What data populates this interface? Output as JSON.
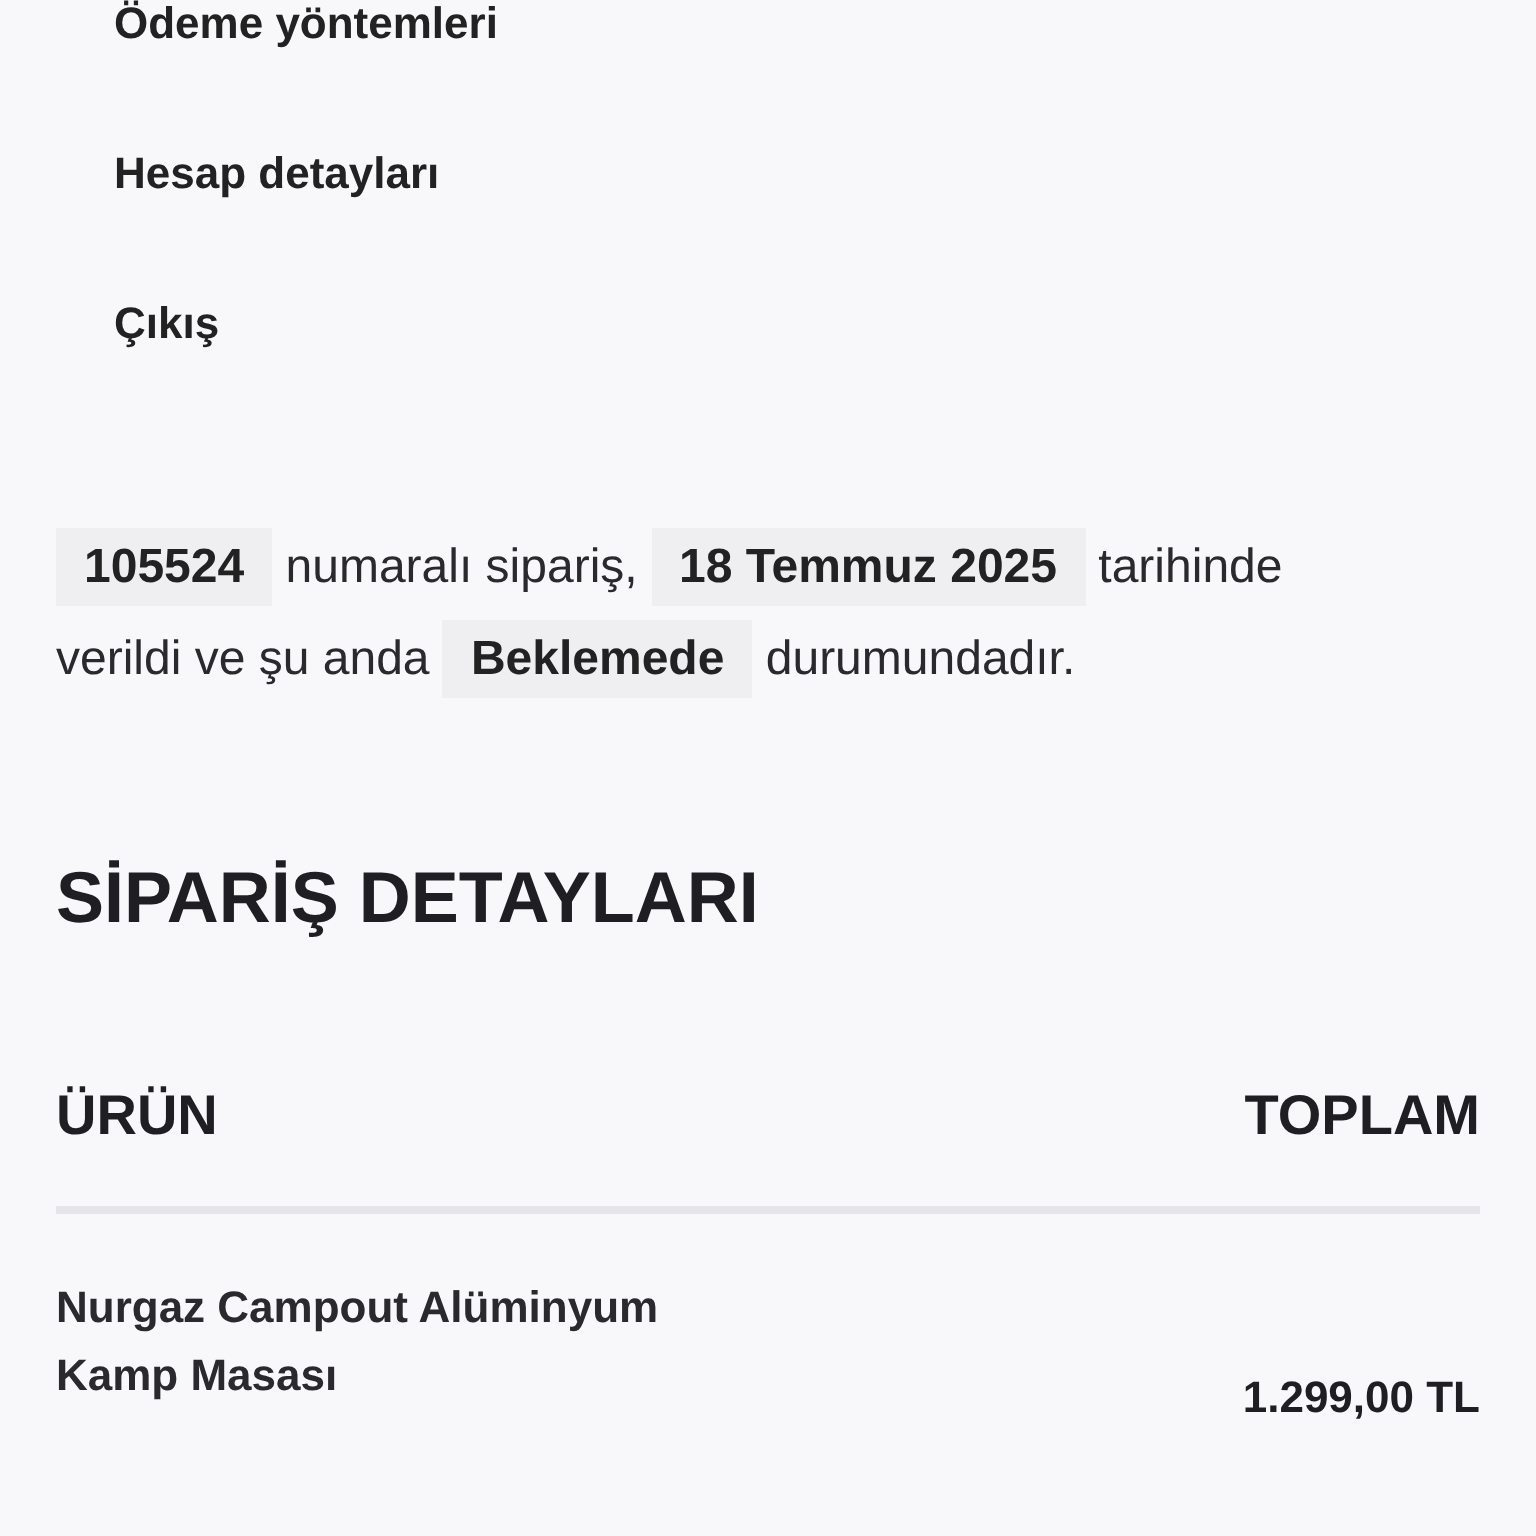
{
  "account_menu": {
    "items": [
      {
        "label": "Ödeme yöntemleri"
      },
      {
        "label": "Hesap detayları"
      },
      {
        "label": "Çıkış"
      }
    ]
  },
  "order_notice": {
    "order_number": "105524",
    "text_1": "numaralı sipariş,",
    "date": "18 Temmuz 2025",
    "text_2": "tarihinde verildi ve şu anda",
    "status": "Beklemede",
    "text_3": "durumundadır."
  },
  "order_details": {
    "title": "SİPARİŞ DETAYLARI",
    "columns": [
      "ÜRÜN",
      "TOPLAM"
    ],
    "rows": [
      {
        "product": "Nurgaz Campout Alüminyum Kamp Masası",
        "total": "1.299,00 TL"
      }
    ]
  }
}
